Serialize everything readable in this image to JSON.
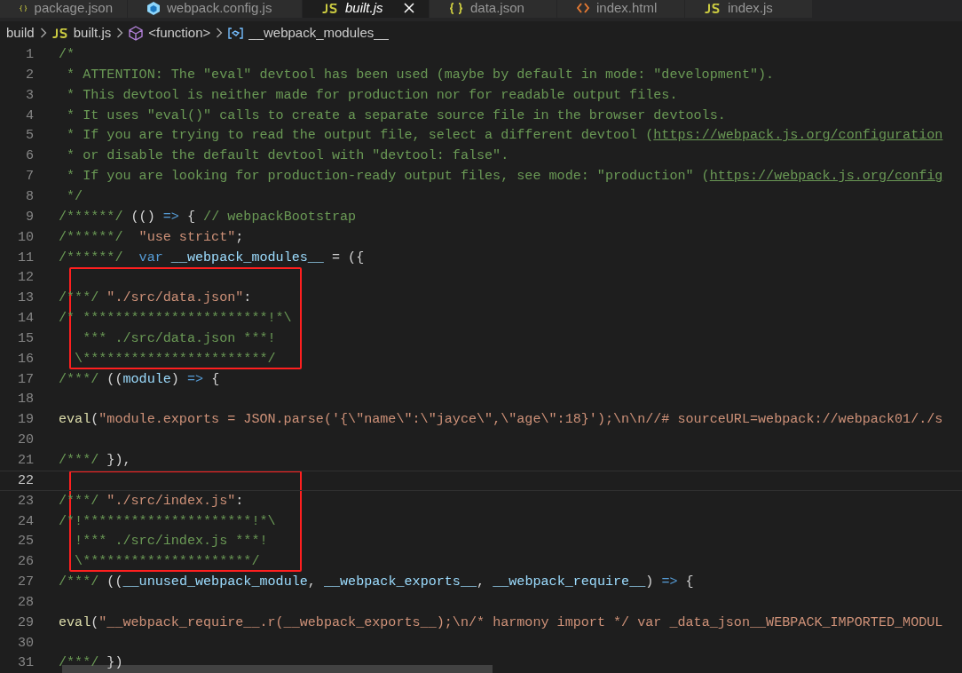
{
  "tabs": [
    {
      "label": "package.json",
      "kind": "json",
      "selected": false,
      "preview": false
    },
    {
      "label": "webpack.config.js",
      "kind": "webpack",
      "selected": false,
      "preview": false
    },
    {
      "label": "built.js",
      "kind": "js",
      "selected": true,
      "preview": true
    },
    {
      "label": "data.json",
      "kind": "json",
      "selected": false,
      "preview": false
    },
    {
      "label": "index.html",
      "kind": "html",
      "selected": false,
      "preview": false
    },
    {
      "label": "index.js",
      "kind": "js",
      "selected": false,
      "preview": false
    }
  ],
  "breadcrumb": [
    {
      "label": "build",
      "kind": "folder"
    },
    {
      "label": "built.js",
      "kind": "js"
    },
    {
      "label": "<function>",
      "kind": "function"
    },
    {
      "label": "__webpack_modules__",
      "kind": "variable"
    }
  ],
  "editor": {
    "lines": [
      {
        "number": "1",
        "current": false,
        "marked": false,
        "tokens": [
          {
            "kind": "comment",
            "text": "/*"
          }
        ]
      },
      {
        "number": "2",
        "current": false,
        "marked": false,
        "tokens": [
          {
            "kind": "comment",
            "text": " * ATTENTION: The \"eval\" devtool has been used (maybe by default in mode: \"development\")."
          }
        ]
      },
      {
        "number": "3",
        "current": false,
        "marked": false,
        "tokens": [
          {
            "kind": "comment",
            "text": " * This devtool is neither made for production nor for readable output files."
          }
        ]
      },
      {
        "number": "4",
        "current": false,
        "marked": false,
        "tokens": [
          {
            "kind": "comment",
            "text": " * It uses \"eval()\" calls to create a separate source file in the browser devtools."
          }
        ]
      },
      {
        "number": "5",
        "current": false,
        "marked": false,
        "tokens": [
          {
            "kind": "comment",
            "text": " * If you are trying to read the output file, select a different devtool ("
          },
          {
            "kind": "link",
            "text": "https://webpack.js.org/configuration"
          }
        ]
      },
      {
        "number": "6",
        "current": false,
        "marked": false,
        "tokens": [
          {
            "kind": "comment",
            "text": " * or disable the default devtool with \"devtool: false\"."
          }
        ]
      },
      {
        "number": "7",
        "current": false,
        "marked": false,
        "tokens": [
          {
            "kind": "comment",
            "text": " * If you are looking for production-ready output files, see mode: \"production\" ("
          },
          {
            "kind": "link",
            "text": "https://webpack.js.org/config"
          }
        ]
      },
      {
        "number": "8",
        "current": false,
        "marked": false,
        "tokens": [
          {
            "kind": "comment",
            "text": " */"
          }
        ]
      },
      {
        "number": "9",
        "current": false,
        "marked": false,
        "tokens": [
          {
            "kind": "comment",
            "text": "/******/"
          },
          {
            "kind": "punct",
            "text": " (() "
          },
          {
            "kind": "keyword",
            "text": "=>"
          },
          {
            "kind": "punct",
            "text": " { "
          },
          {
            "kind": "comment",
            "text": "// webpackBootstrap"
          }
        ]
      },
      {
        "number": "10",
        "current": false,
        "marked": false,
        "tokens": [
          {
            "kind": "comment",
            "text": "/******/"
          },
          {
            "kind": "string",
            "text": "  \"use strict\""
          },
          {
            "kind": "punct",
            "text": ";"
          }
        ]
      },
      {
        "number": "11",
        "current": false,
        "marked": false,
        "tokens": [
          {
            "kind": "comment",
            "text": "/******/"
          },
          {
            "kind": "keyword",
            "text": "  var"
          },
          {
            "kind": "variable",
            "text": " __webpack_modules__"
          },
          {
            "kind": "punct",
            "text": " = ({"
          }
        ]
      },
      {
        "number": "12",
        "current": false,
        "marked": true
      },
      {
        "number": "13",
        "current": false,
        "marked": true,
        "tokens": [
          {
            "kind": "comment",
            "text": "/***/"
          },
          {
            "kind": "string",
            "text": " \"./src/data.json\""
          },
          {
            "kind": "punct",
            "text": ":"
          }
        ]
      },
      {
        "number": "14",
        "current": false,
        "marked": true,
        "tokens": [
          {
            "kind": "comment",
            "text": "/* ***********************!*\\"
          }
        ]
      },
      {
        "number": "15",
        "current": false,
        "marked": true,
        "tokens": [
          {
            "kind": "comment",
            "text": "   *** ./src/data.json ***!"
          }
        ]
      },
      {
        "number": "16",
        "current": false,
        "marked": true,
        "tokens": [
          {
            "kind": "comment",
            "text": "  \\***********************/"
          }
        ]
      },
      {
        "number": "17",
        "current": false,
        "marked": false,
        "tokens": [
          {
            "kind": "comment",
            "text": "/***/"
          },
          {
            "kind": "punct",
            "text": " (("
          },
          {
            "kind": "variable",
            "text": "module"
          },
          {
            "kind": "punct",
            "text": ") "
          },
          {
            "kind": "keyword",
            "text": "=>"
          },
          {
            "kind": "punct",
            "text": " {"
          }
        ]
      },
      {
        "number": "18",
        "current": false,
        "marked": false
      },
      {
        "number": "19",
        "current": false,
        "marked": false,
        "tokens": [
          {
            "kind": "function",
            "text": "eval"
          },
          {
            "kind": "punct",
            "text": "("
          },
          {
            "kind": "string",
            "text": "\"module.exports = JSON.parse('{\\\"name\\\":\\\"jayce\\\",\\\"age\\\":18}');\\n\\n//# sourceURL=webpack://webpack01/./s"
          }
        ]
      },
      {
        "number": "20",
        "current": false,
        "marked": false
      },
      {
        "number": "21",
        "current": false,
        "marked": false,
        "tokens": [
          {
            "kind": "comment",
            "text": "/***/"
          },
          {
            "kind": "punct",
            "text": " }),"
          }
        ]
      },
      {
        "number": "22",
        "current": true,
        "marked": true
      },
      {
        "number": "23",
        "current": false,
        "marked": true,
        "tokens": [
          {
            "kind": "comment",
            "text": "/***/"
          },
          {
            "kind": "string",
            "text": " \"./src/index.js\""
          },
          {
            "kind": "punct",
            "text": ":"
          }
        ]
      },
      {
        "number": "24",
        "current": false,
        "marked": true,
        "tokens": [
          {
            "kind": "comment",
            "text": "/*!*********************!*\\"
          }
        ]
      },
      {
        "number": "25",
        "current": false,
        "marked": true,
        "tokens": [
          {
            "kind": "comment",
            "text": "  !*** ./src/index.js ***!"
          }
        ]
      },
      {
        "number": "26",
        "current": false,
        "marked": true,
        "tokens": [
          {
            "kind": "comment",
            "text": "  \\*********************/"
          }
        ]
      },
      {
        "number": "27",
        "current": false,
        "marked": false,
        "tokens": [
          {
            "kind": "comment",
            "text": "/***/"
          },
          {
            "kind": "punct",
            "text": " (("
          },
          {
            "kind": "variable",
            "text": "__unused_webpack_module"
          },
          {
            "kind": "punct",
            "text": ", "
          },
          {
            "kind": "variable",
            "text": "__webpack_exports__"
          },
          {
            "kind": "punct",
            "text": ", "
          },
          {
            "kind": "variable",
            "text": "__webpack_require__"
          },
          {
            "kind": "punct",
            "text": ") "
          },
          {
            "kind": "keyword",
            "text": "=>"
          },
          {
            "kind": "punct",
            "text": " {"
          }
        ]
      },
      {
        "number": "28",
        "current": false,
        "marked": false
      },
      {
        "number": "29",
        "current": false,
        "marked": false,
        "tokens": [
          {
            "kind": "function",
            "text": "eval"
          },
          {
            "kind": "punct",
            "text": "("
          },
          {
            "kind": "string",
            "text": "\"__webpack_require__.r(__webpack_exports__);\\n/* harmony import */ var _data_json__WEBPACK_IMPORTED_MODUL"
          }
        ]
      },
      {
        "number": "30",
        "current": false,
        "marked": false
      },
      {
        "number": "31",
        "current": false,
        "marked": false,
        "tokens": [
          {
            "kind": "comment",
            "text": "/***/"
          },
          {
            "kind": "punct",
            "text": " })"
          }
        ]
      }
    ]
  }
}
